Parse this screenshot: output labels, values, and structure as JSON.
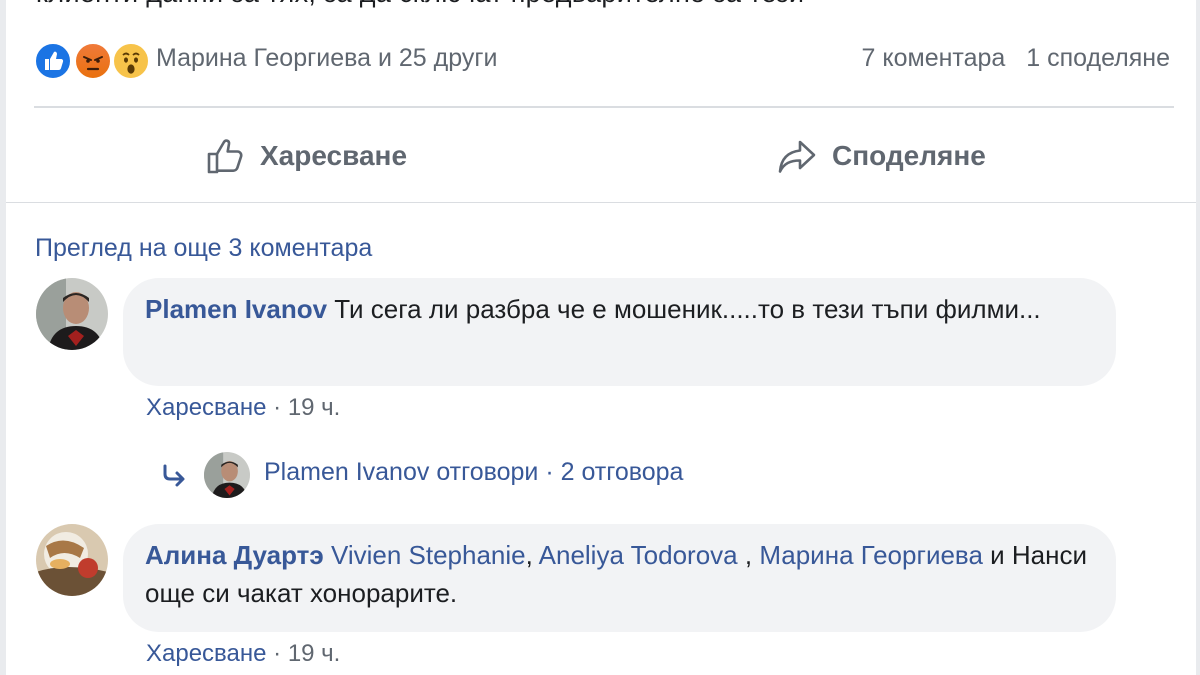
{
  "post": {
    "text_partial": "клиенти данни за тях, за да сключат предварително за тези"
  },
  "reactions": {
    "icons": [
      "like-icon",
      "angry-icon",
      "wow-icon"
    ],
    "summary": "Марина Георгиева и 25 други",
    "comments_count": "7 коментара",
    "shares_count": "1 споделяне"
  },
  "actions": {
    "like_label": "Харесване",
    "share_label": "Споделяне"
  },
  "comments_section": {
    "view_more": "Преглед на още 3 коментара",
    "comments": [
      {
        "author": "Plamen Ivanov",
        "text": " Ти сега ли разбра че е мошеник.....то в тези тъпи филми...",
        "like_label": "Харесване",
        "separator": " · ",
        "time": "19 ч.",
        "replies_author": "Plamen Ivanov",
        "replies_action": " отговори",
        "replies_separator": " · ",
        "replies_count": "2 отговора"
      },
      {
        "author": "Алина Дуартэ",
        "mention_1": "Vivien Stephanie",
        "sep_1": ", ",
        "mention_2": "Aneliya Todorova",
        "sep_2": " , ",
        "mention_3": "Марина Георгиева",
        "text": " и Нанси още си чакат хонорарите.",
        "like_label": "Харесване",
        "separator": " · ",
        "time": "19 ч."
      }
    ]
  },
  "colors": {
    "link": "#385898",
    "secondary_text": "#606770",
    "bubble": "#f2f3f5",
    "like_blue": "#1b74e4"
  }
}
